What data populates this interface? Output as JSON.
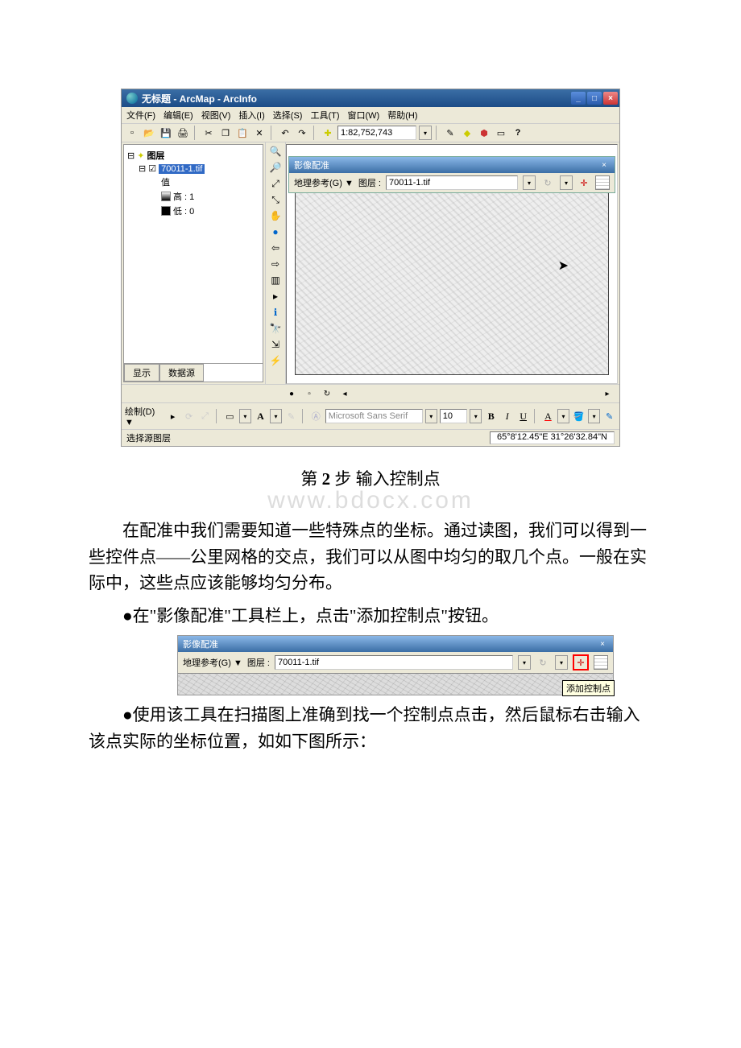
{
  "app": {
    "title": "无标题 - ArcMap - ArcInfo",
    "menus": {
      "file": "文件(F)",
      "edit": "编辑(E)",
      "view": "视图(V)",
      "insert": "插入(I)",
      "select": "选择(S)",
      "tools": "工具(T)",
      "window": "窗口(W)",
      "help": "帮助(H)"
    },
    "scale": "1:82,752,743",
    "toc": {
      "root": "图层",
      "layer": "70011-1.tif",
      "value_label": "值",
      "high": "高 : 1",
      "low": "低 : 0",
      "tab_display": "显示",
      "tab_source": "数据源"
    },
    "georef": {
      "title": "影像配准",
      "menu": "地理参考(G) ▼",
      "layer_label": "图层 :",
      "layer_value": "70011-1.tif",
      "tooltip": "添加控制点"
    },
    "draw": {
      "label": "绘制(D) ▼",
      "font": "Microsoft Sans Serif",
      "size": "10"
    },
    "status": {
      "left": "选择源图层",
      "coords": "65°8'12.45\"E  31°26'32.84\"N"
    }
  },
  "doc": {
    "watermark": "www.bdocx.com",
    "step_title_pre": "第 ",
    "step_num": "2",
    "step_title_post": " 步 输入控制点",
    "p1": "在配准中我们需要知道一些特殊点的坐标。通过读图，我们可以得到一些控件点——公里网格的交点，我们可以从图中均匀的取几个点。一般在实际中，这些点应该能够均匀分布。",
    "b1": "●在\"影像配准\"工具栏上，点击\"添加控制点\"按钮。",
    "b2": "●使用该工具在扫描图上准确到找一个控制点点击，然后鼠标右击输入该点实际的坐标位置，如如下图所示："
  }
}
